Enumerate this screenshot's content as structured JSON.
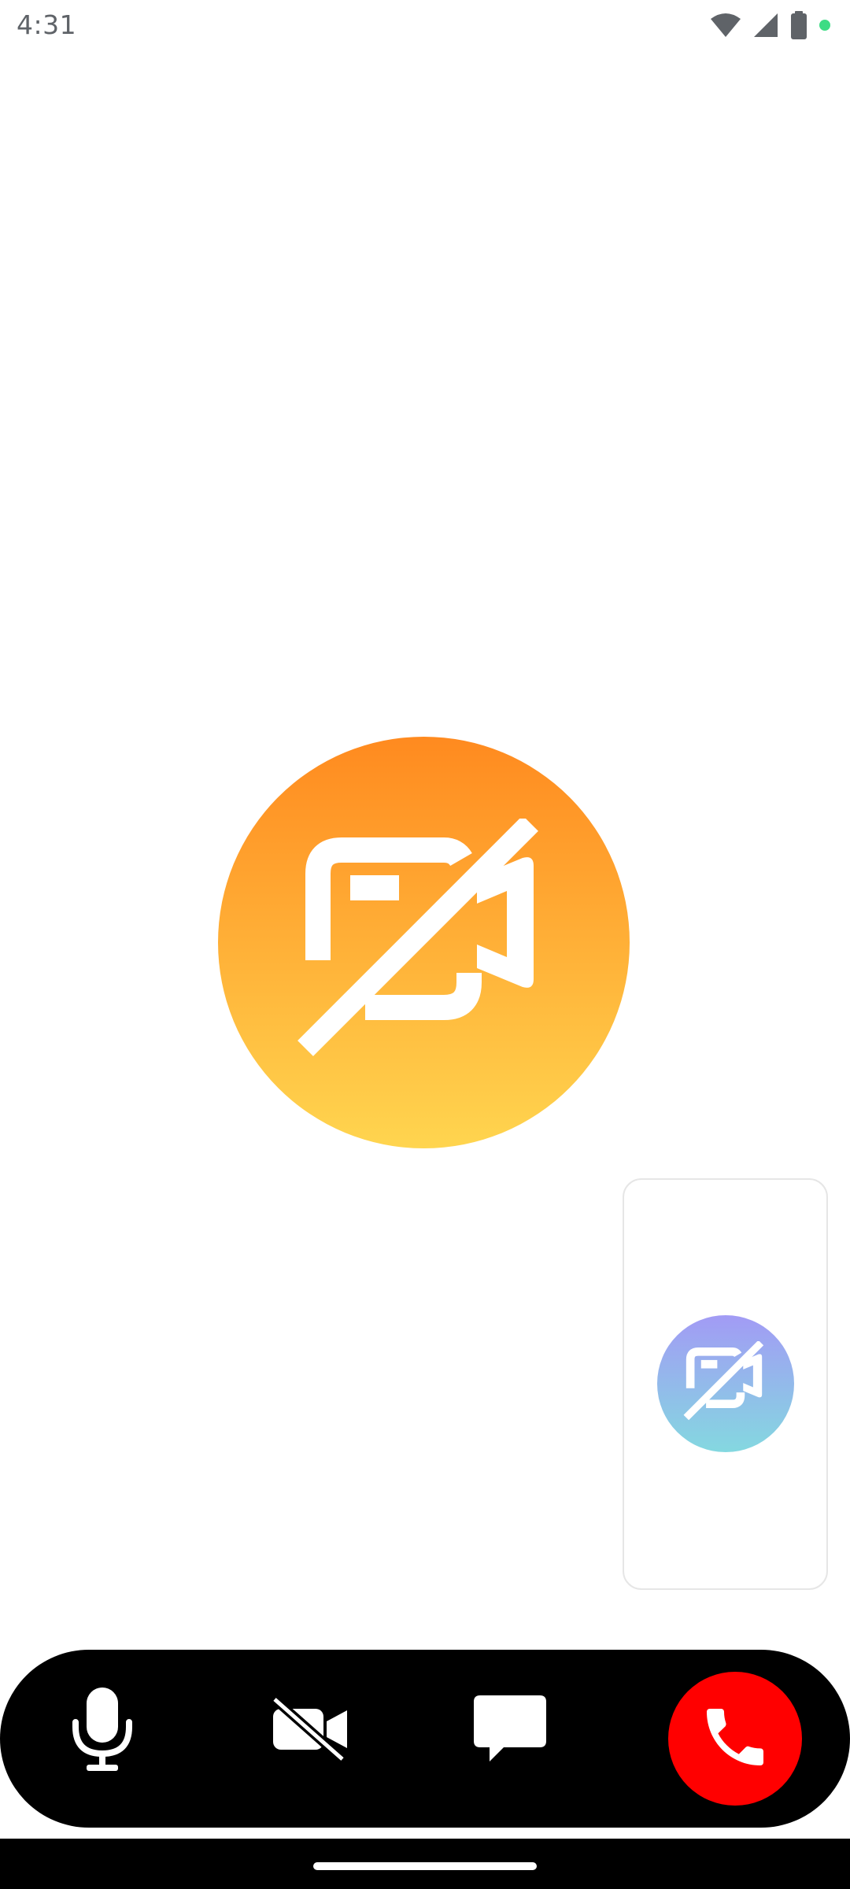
{
  "status_bar": {
    "time": "4:31",
    "icons": [
      "wifi-icon",
      "cellular-signal-icon",
      "battery-icon",
      "privacy-indicator-dot"
    ],
    "indicator_color": "#3ddc84"
  },
  "remote_video": {
    "icon": "video-off-icon",
    "gradient": [
      "#ff8a1f",
      "#ffd54f"
    ]
  },
  "local_preview": {
    "icon": "video-off-icon",
    "gradient": [
      "#a29bf5",
      "#84d8e0"
    ]
  },
  "controls": {
    "mic": "microphone-icon",
    "video": "video-off-icon",
    "chat": "chat-bubble-icon",
    "end_call": "phone-hangup-icon",
    "end_call_color": "#ff0000"
  }
}
